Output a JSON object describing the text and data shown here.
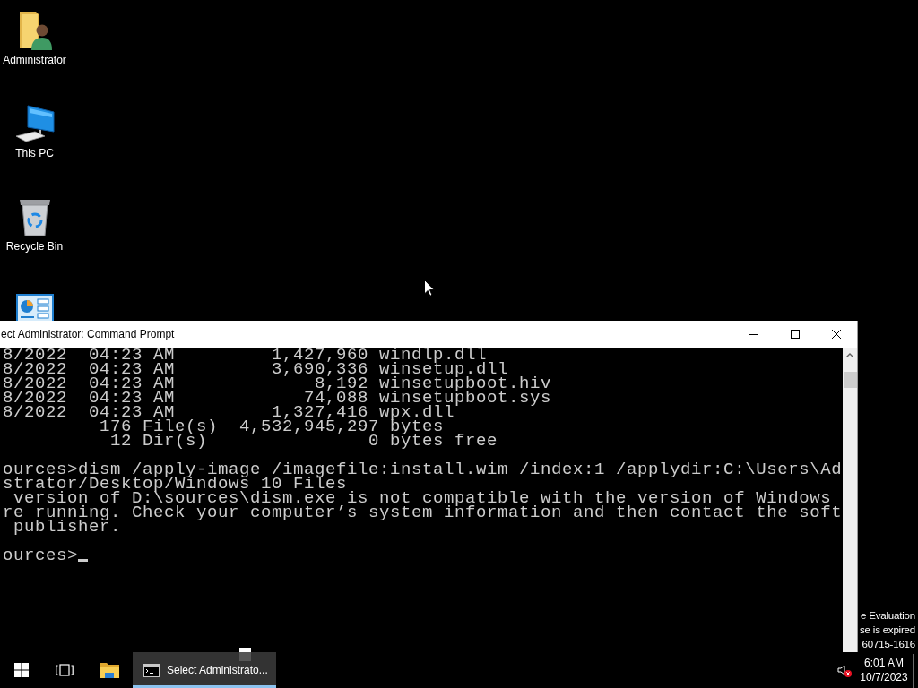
{
  "desktop_icons": [
    {
      "kind": "user_folder",
      "label": "Administrator"
    },
    {
      "kind": "computer",
      "label": "This PC"
    },
    {
      "kind": "recycle_bin",
      "label": "Recycle Bin"
    },
    {
      "kind": "chart_tile"
    }
  ],
  "desktop_notice": {
    "lines": [
      "e Evaluation",
      "se is expired",
      "60715-1616"
    ]
  },
  "window": {
    "title": "ect Administrator: Command Prompt",
    "console": {
      "blocks": [
        [
          "8/2022  04:23 AM         1,427,960 windlp.dll",
          "8/2022  04:23 AM         3,690,336 winsetup.dll",
          "8/2022  04:23 AM             8,192 winsetupboot.hiv",
          "8/2022  04:23 AM            74,088 winsetupboot.sys",
          "8/2022  04:23 AM         1,327,416 wpx.dll",
          "         176 File(s)  4,532,945,297 bytes",
          "          12 Dir(s)               0 bytes free"
        ],
        [
          "ources>dism /apply-image /imagefile:install.wim /index:1 /applydir:C:\\Users\\Ad",
          "strator/Desktop/Windows 10 Files",
          " version of D:\\sources\\dism.exe is not compatible with the version of Windows",
          "re running. Check your computer’s system information and then contact the soft",
          " publisher."
        ],
        [
          "ources>"
        ]
      ],
      "cursor": true
    }
  },
  "taskbar": {
    "items": [
      {
        "kind": "start",
        "selected": false
      },
      {
        "kind": "task_view",
        "selected": false
      },
      {
        "kind": "file_explorer",
        "selected": false
      },
      {
        "kind": "window",
        "label": "Select Administrato...",
        "selected": true
      }
    ],
    "tray": {
      "muted": true,
      "time": "6:01 AM",
      "date": "10/7/2023"
    }
  }
}
